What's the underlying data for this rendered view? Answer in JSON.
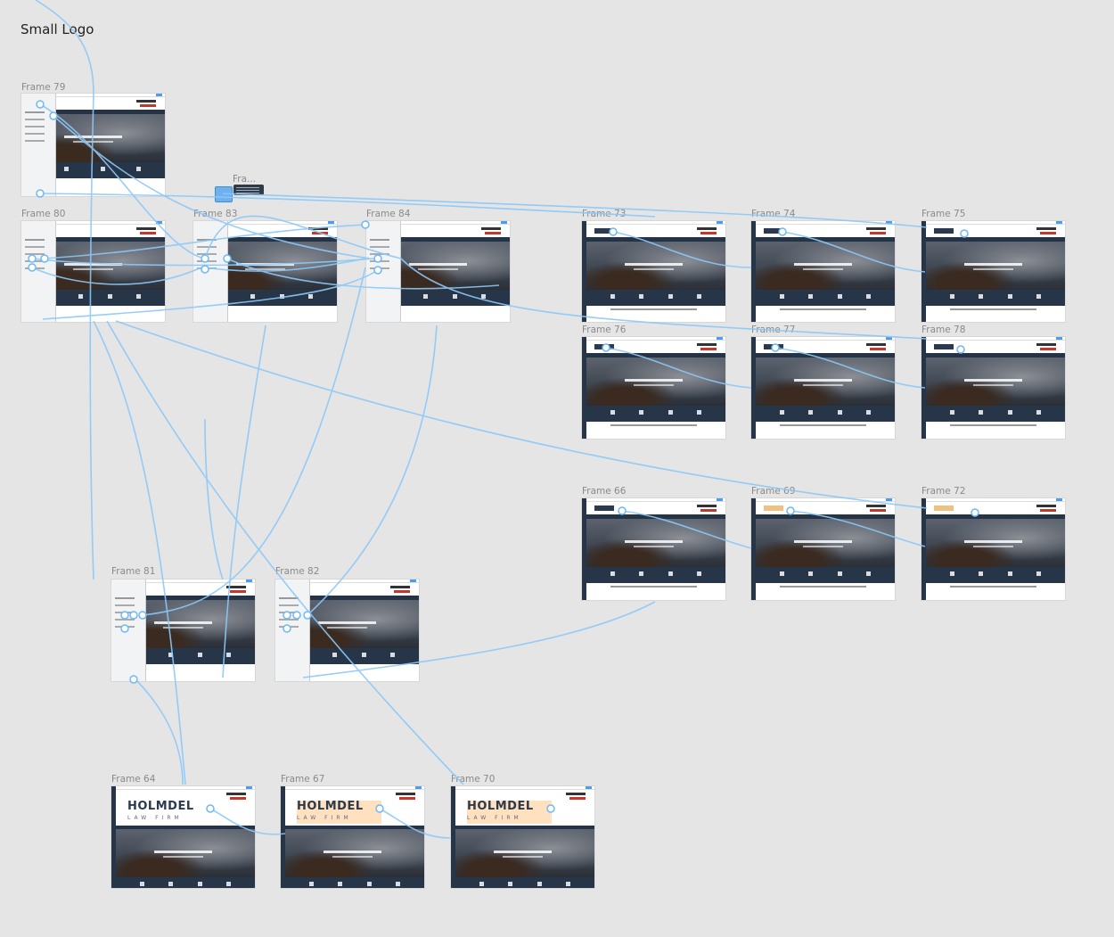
{
  "canvas": {
    "title": "Small Logo",
    "tooltip_frame_label": "Fra...",
    "accent": "#6fb8f5",
    "background": "#e5e5e5"
  },
  "frames": [
    {
      "id": "79",
      "label": "Frame 79"
    },
    {
      "id": "80",
      "label": "Frame 80"
    },
    {
      "id": "83",
      "label": "Frame 83"
    },
    {
      "id": "84",
      "label": "Frame 84"
    },
    {
      "id": "73",
      "label": "Frame 73"
    },
    {
      "id": "74",
      "label": "Frame 74"
    },
    {
      "id": "75",
      "label": "Frame 75"
    },
    {
      "id": "76",
      "label": "Frame 76"
    },
    {
      "id": "77",
      "label": "Frame 77"
    },
    {
      "id": "78",
      "label": "Frame 78"
    },
    {
      "id": "66",
      "label": "Frame 66"
    },
    {
      "id": "69",
      "label": "Frame 69"
    },
    {
      "id": "72",
      "label": "Frame 72"
    },
    {
      "id": "81",
      "label": "Frame 81"
    },
    {
      "id": "82",
      "label": "Frame 82"
    },
    {
      "id": "64",
      "label": "Frame 64"
    },
    {
      "id": "67",
      "label": "Frame 67"
    },
    {
      "id": "70",
      "label": "Frame 70"
    }
  ],
  "logo": {
    "name": "HOLMDEL",
    "tagline": "LAW FIRM"
  },
  "icons": {
    "interaction": "prototype-connection-icon"
  }
}
